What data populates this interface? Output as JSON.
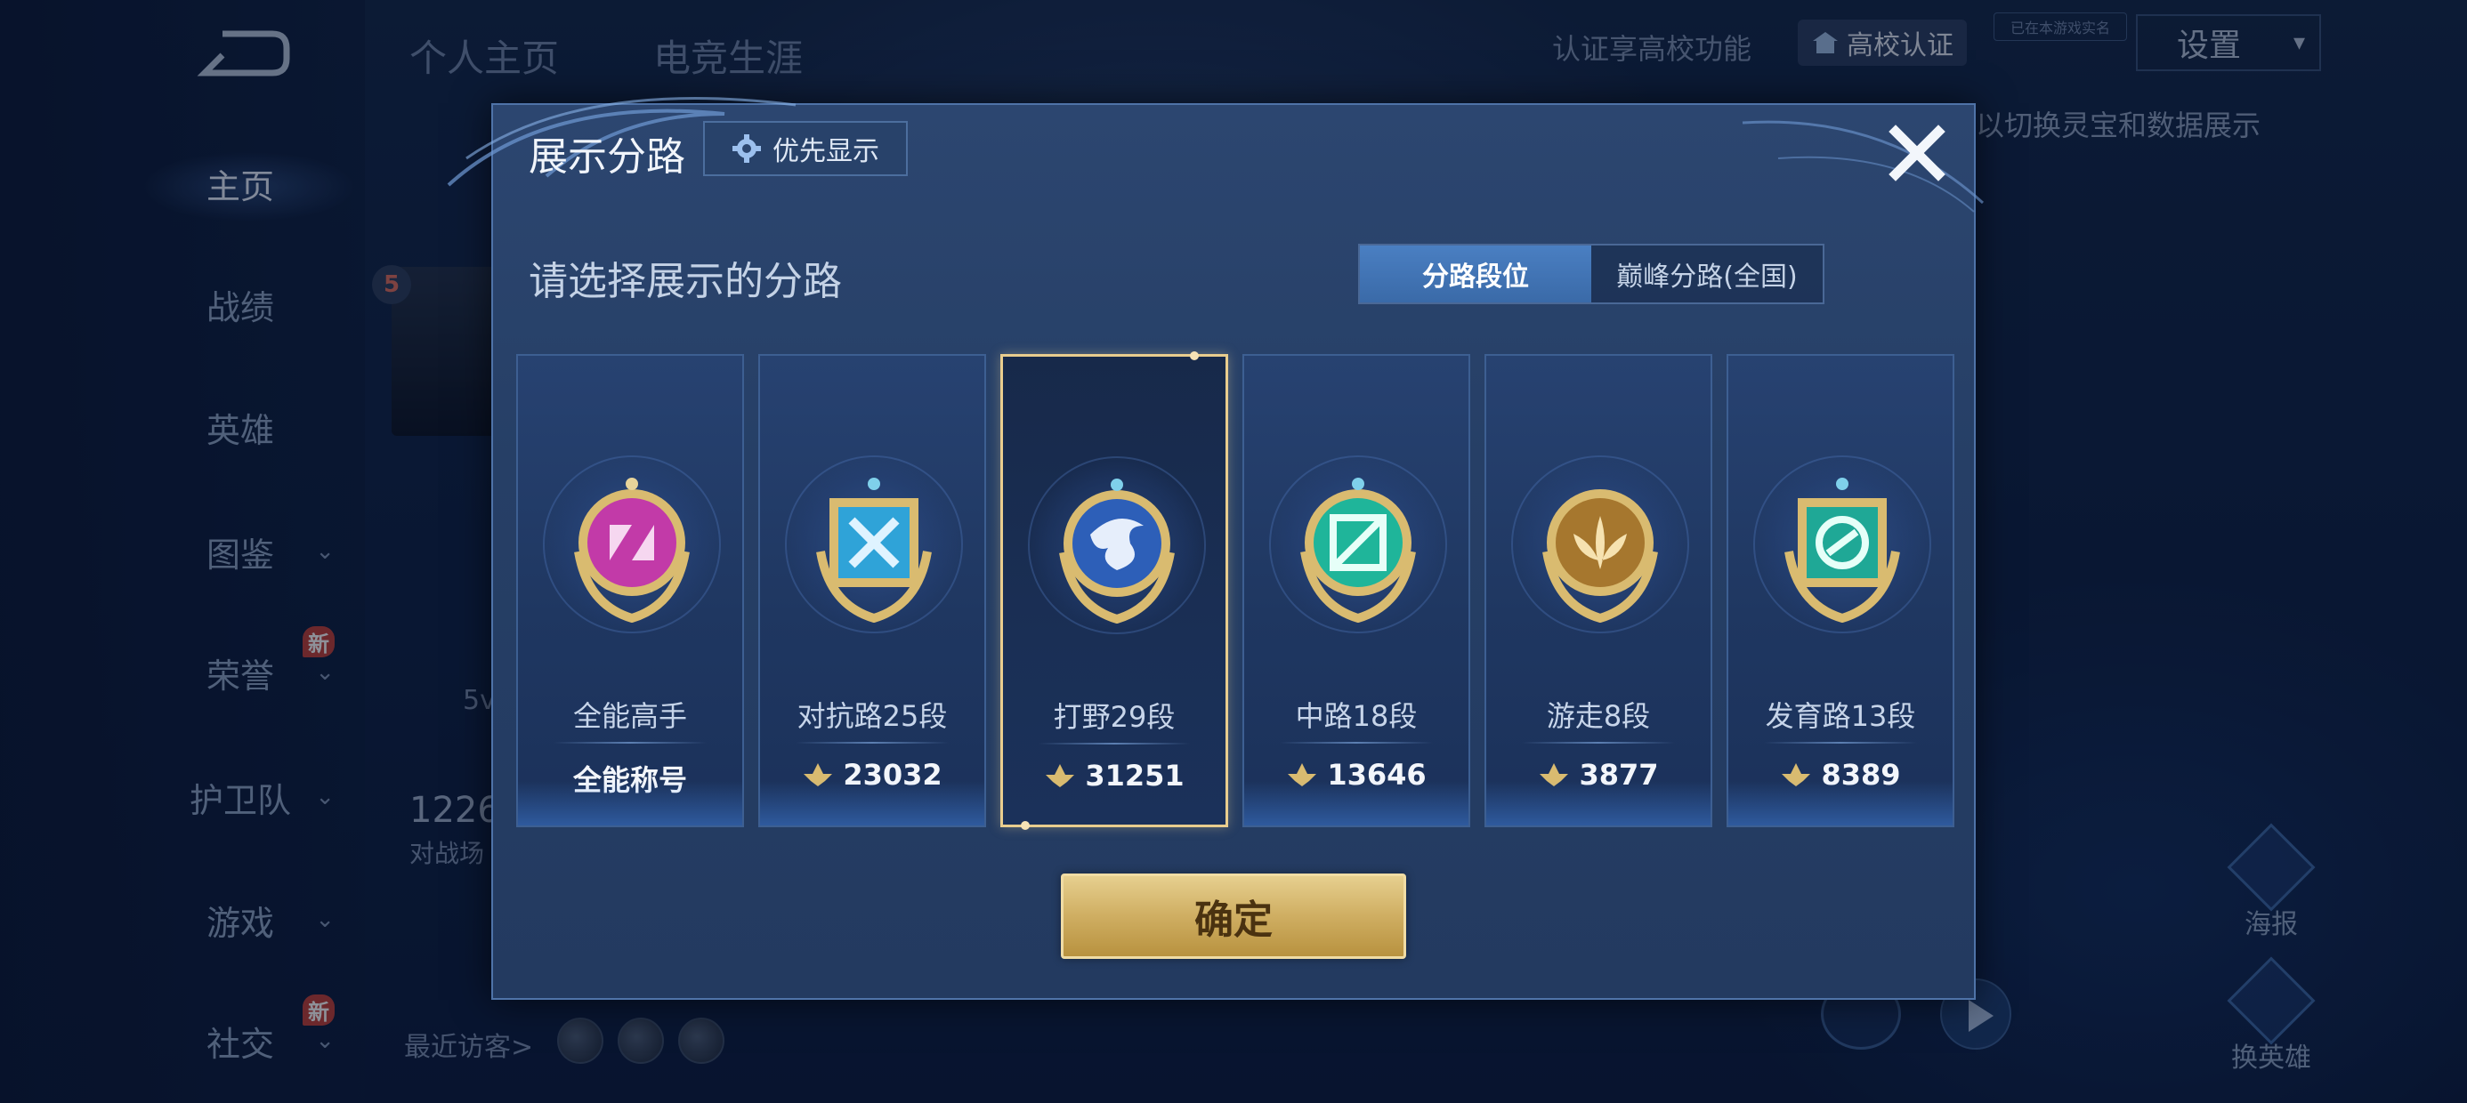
{
  "sidebar": {
    "items": [
      {
        "label": "主页"
      },
      {
        "label": "战绩"
      },
      {
        "label": "英雄"
      },
      {
        "label": "图鉴"
      },
      {
        "label": "荣誉",
        "badge": "新"
      },
      {
        "label": "护卫队"
      },
      {
        "label": "游戏"
      },
      {
        "label": "社交",
        "badge": "新"
      }
    ]
  },
  "header": {
    "tabs": [
      {
        "label": "个人主页"
      },
      {
        "label": "电竞生涯"
      }
    ],
    "campus_text": "认证享高校功能",
    "campus_button": "高校认证",
    "small_tag": "已在本游戏实名",
    "settings": "设置",
    "hint": "以切换灵宝和数据展示"
  },
  "background": {
    "level_badge": "5",
    "count_text": "5v",
    "stat_value": "1226",
    "stat_label": "对战场",
    "visitors_label": "最近访客>",
    "poster_label": "海报",
    "swap_hero_label": "换英雄"
  },
  "modal": {
    "title": "展示分路",
    "priority_button": "优先显示",
    "prompt": "请选择展示的分路",
    "segments": [
      {
        "label": "分路段位",
        "active": true
      },
      {
        "label": "巅峰分路(全国)",
        "active": false
      }
    ],
    "cards": [
      {
        "role": "全能高手",
        "score": "全能称号",
        "emblem": "allround-emblem-icon",
        "color": "#c23aa8",
        "has_score_icon": false,
        "selected": false
      },
      {
        "role": "对抗路25段",
        "score": "23032",
        "emblem": "clash-lane-emblem-icon",
        "color": "#2fa3d8",
        "has_score_icon": true,
        "selected": false
      },
      {
        "role": "打野29段",
        "score": "31251",
        "emblem": "jungle-emblem-icon",
        "color": "#2d5fb8",
        "has_score_icon": true,
        "selected": true
      },
      {
        "role": "中路18段",
        "score": "13646",
        "emblem": "mid-lane-emblem-icon",
        "color": "#1fb59a",
        "has_score_icon": true,
        "selected": false
      },
      {
        "role": "游走8段",
        "score": "3877",
        "emblem": "roam-emblem-icon",
        "color": "#a6772e",
        "has_score_icon": true,
        "selected": false
      },
      {
        "role": "发育路13段",
        "score": "8389",
        "emblem": "farm-lane-emblem-icon",
        "color": "#1fa896",
        "has_score_icon": true,
        "selected": false
      }
    ],
    "confirm": "确定"
  },
  "colors": {
    "accent_gold": "#d9bb70",
    "panel": "#263f66",
    "active_segment": "#4179be"
  }
}
